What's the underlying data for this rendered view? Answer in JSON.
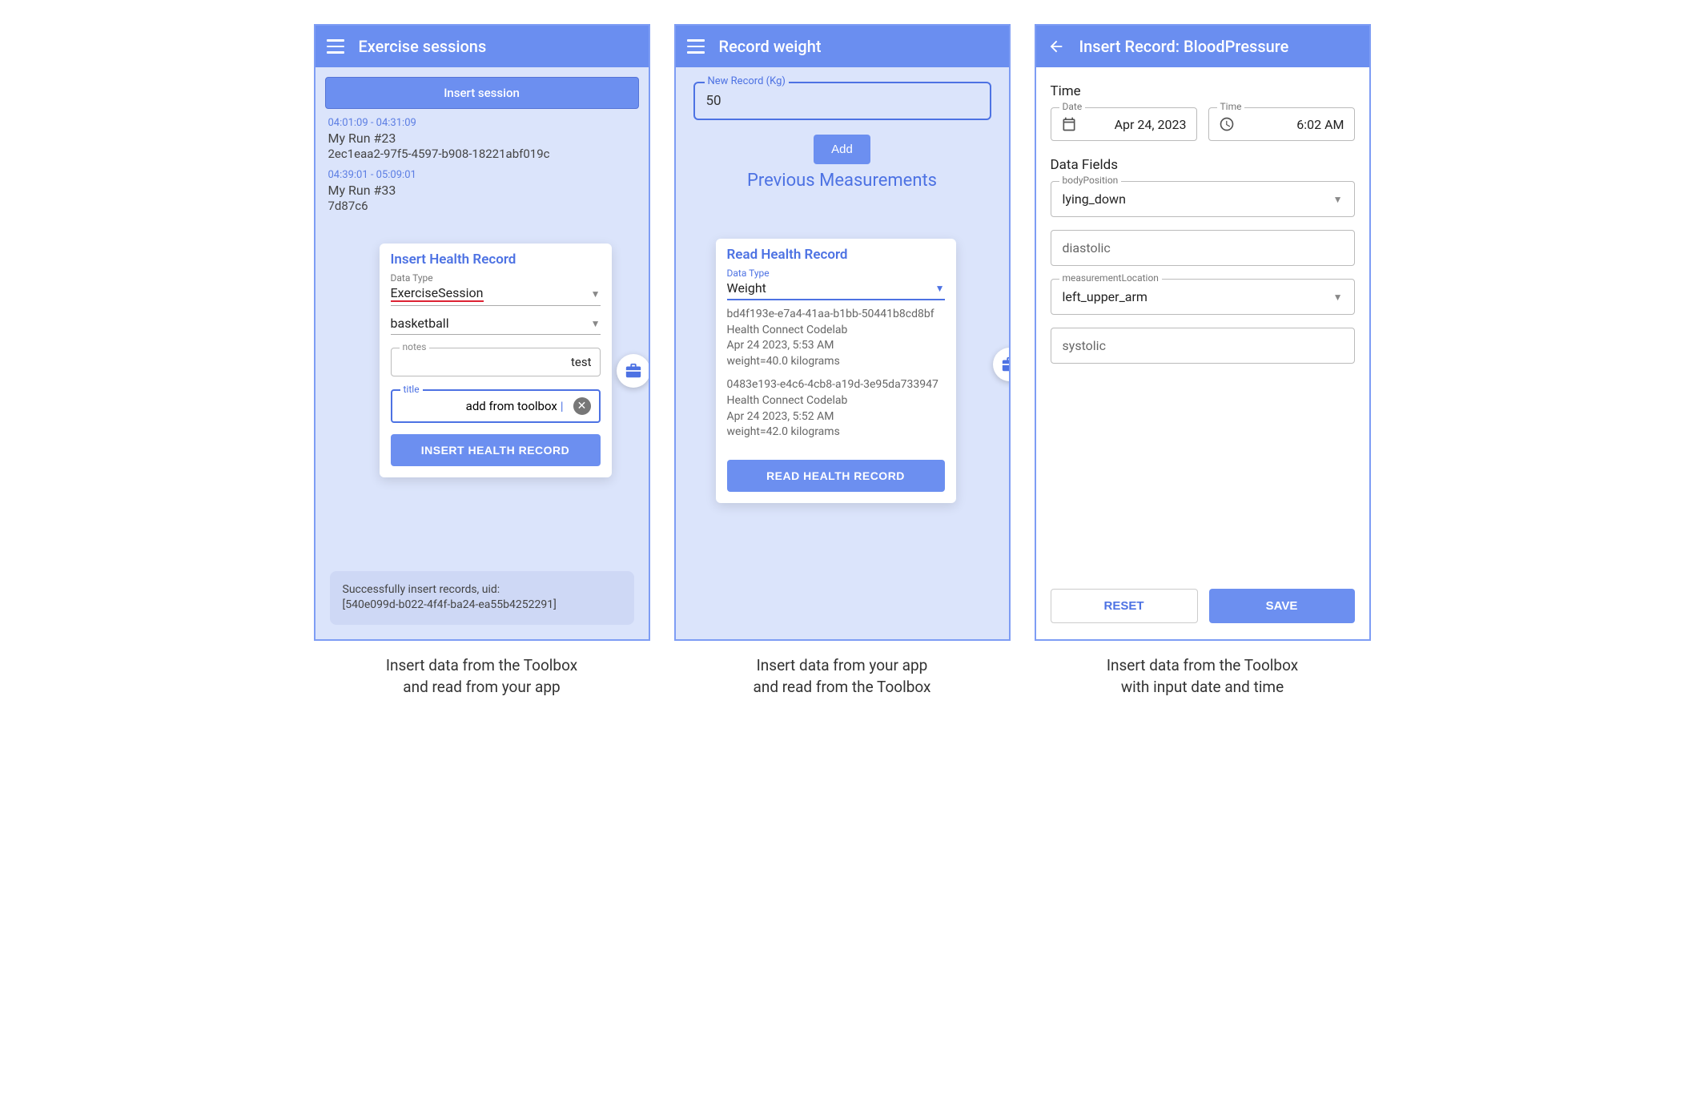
{
  "panel1": {
    "appbar_title": "Exercise sessions",
    "insert_session_label": "Insert session",
    "items": [
      {
        "time": "04:01:09 - 04:31:09",
        "title": "My Run #23",
        "sub": "2ec1eaa2-97f5-4597-b908-18221abf019c"
      },
      {
        "time": "04:39:01 - 05:09:01",
        "title": "My Run #33",
        "sub": "7d87c6"
      }
    ],
    "card": {
      "title": "Insert Health Record",
      "data_type_label": "Data Type",
      "data_type_value": "ExerciseSession",
      "exercise_type_value": "basketball",
      "notes_label": "notes",
      "notes_value": "test",
      "title_label": "title",
      "title_value": "add from toolbox",
      "button": "INSERT HEALTH RECORD"
    },
    "snackbar_line1": "Successfully insert records, uid:",
    "snackbar_line2": "[540e099d-b022-4f4f-ba24-ea55b4252291]",
    "caption_line1": "Insert data from the Toolbox",
    "caption_line2": "and read from your app"
  },
  "panel2": {
    "appbar_title": "Record weight",
    "new_record_label": "New Record (Kg)",
    "new_record_value": "50",
    "add_label": "Add",
    "prev_heading": "Previous Measurements",
    "card": {
      "title": "Read Health Record",
      "data_type_label": "Data Type",
      "data_type_value": "Weight",
      "records": [
        {
          "id": "bd4f193e-e7a4-41aa-b1bb-50441b8cd8bf",
          "source": "Health Connect Codelab",
          "time": "Apr 24 2023, 5:53 AM",
          "value": "  weight=40.0 kilograms"
        },
        {
          "id": "0483e193-e4c6-4cb8-a19d-3e95da733947",
          "source": "Health Connect Codelab",
          "time": "Apr 24 2023, 5:52 AM",
          "value": "  weight=42.0 kilograms"
        }
      ],
      "button": "READ HEALTH RECORD"
    },
    "caption_line1": "Insert data from your app",
    "caption_line2": "and read from the Toolbox"
  },
  "panel3": {
    "appbar_title": "Insert Record: BloodPressure",
    "time_heading": "Time",
    "date_label": "Date",
    "date_value": "Apr 24, 2023",
    "time_label": "Time",
    "time_value": "6:02 AM",
    "datafields_heading": "Data Fields",
    "fields": {
      "bodyPosition_label": "bodyPosition",
      "bodyPosition_value": "lying_down",
      "diastolic_placeholder": "diastolic",
      "measurementLocation_label": "measurementLocation",
      "measurementLocation_value": "left_upper_arm",
      "systolic_placeholder": "systolic"
    },
    "reset_label": "RESET",
    "save_label": "SAVE",
    "caption_line1": "Insert data from the Toolbox",
    "caption_line2": "with input date and time"
  }
}
